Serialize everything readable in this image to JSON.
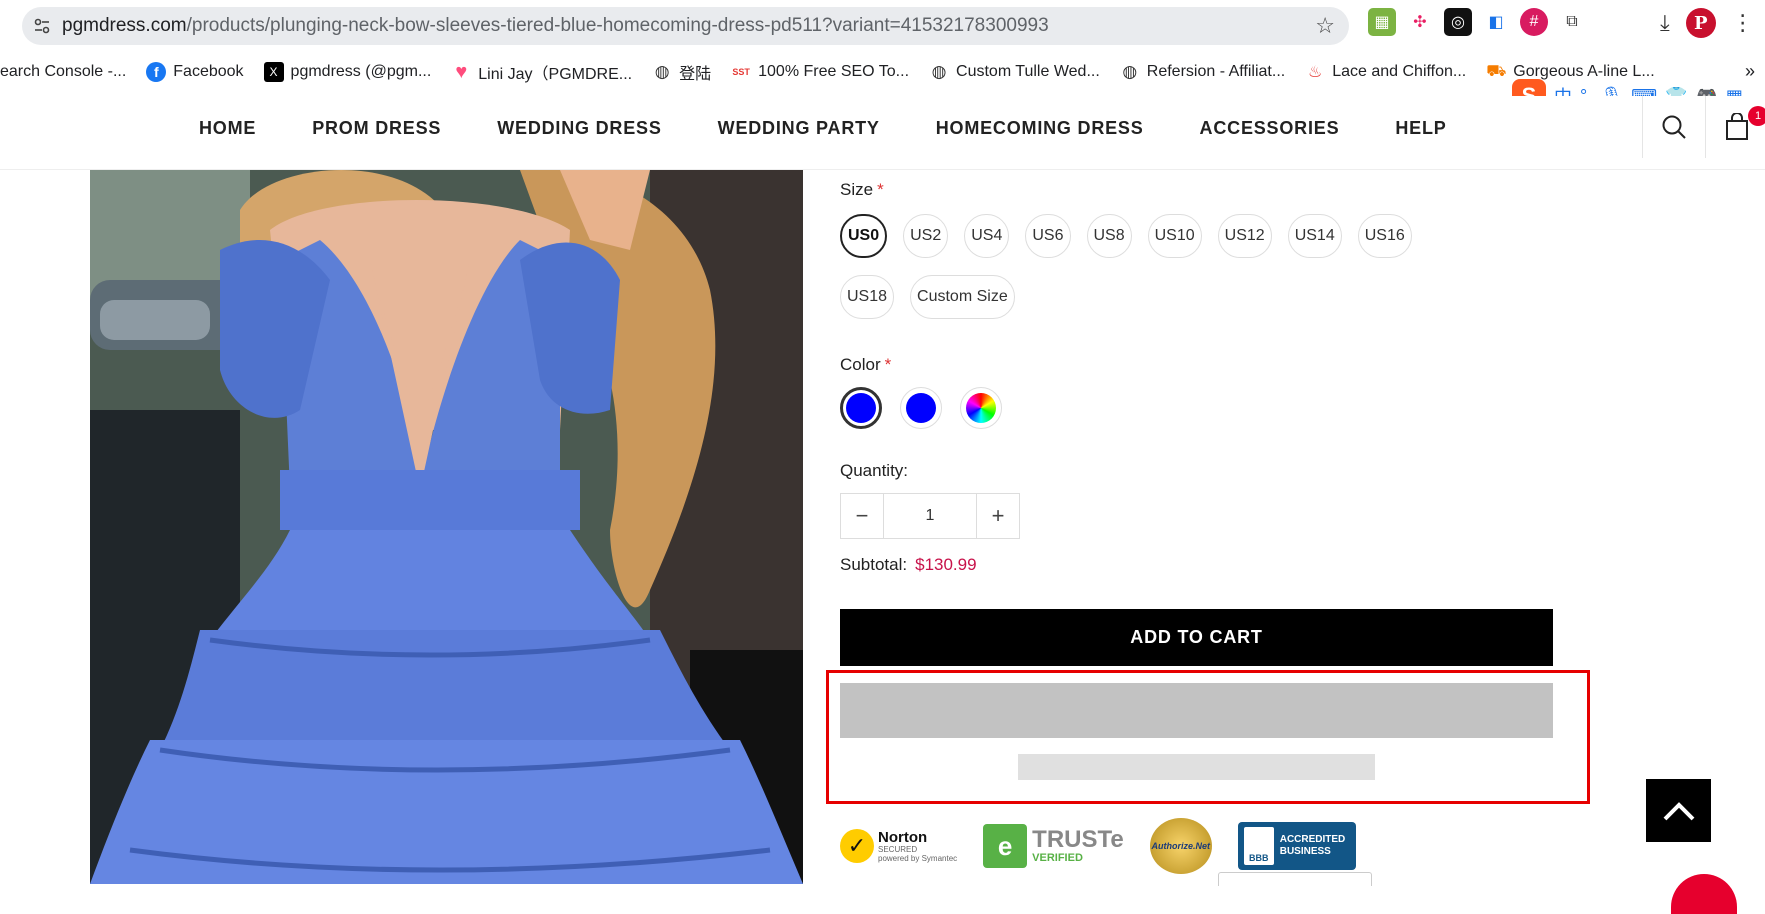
{
  "browser": {
    "url_domain": "pgmdress.com",
    "url_path": "/products/plunging-neck-bow-sleeves-tiered-blue-homecoming-dress-pd511?variant=41532178300993",
    "bookmarks": [
      {
        "label": "earch Console -...",
        "icon": "search-console-icon"
      },
      {
        "label": "Facebook",
        "icon": "facebook-icon"
      },
      {
        "label": "pgmdress (@pgm...",
        "icon": "x-icon"
      },
      {
        "label": "Lini Jay（PGMDRE...",
        "icon": "heart-icon"
      },
      {
        "label": "登陆",
        "icon": "globe-icon"
      },
      {
        "label": "100% Free SEO To...",
        "icon": "sst-icon"
      },
      {
        "label": "Custom Tulle Wed...",
        "icon": "globe-icon"
      },
      {
        "label": "Refersion - Affiliat...",
        "icon": "globe-icon"
      },
      {
        "label": "Lace and Chiffon...",
        "icon": "flame-icon"
      },
      {
        "label": "Gorgeous A-line L...",
        "icon": "cart-icon"
      }
    ],
    "ime": {
      "logo": "S",
      "mode": "中"
    },
    "profile_initial": "P"
  },
  "nav": {
    "items": [
      "HOME",
      "PROM DRESS",
      "WEDDING DRESS",
      "WEDDING PARTY",
      "HOMECOMING DRESS",
      "ACCESSORIES",
      "HELP"
    ],
    "cart_count": "1"
  },
  "product": {
    "size_label": "Size",
    "required_mark": "*",
    "sizes": [
      "US0",
      "US2",
      "US4",
      "US6",
      "US8",
      "US10",
      "US12",
      "US14",
      "US16",
      "US18",
      "Custom Size"
    ],
    "selected_size": "US0",
    "color_label": "Color",
    "colors": [
      {
        "name": "blue-selected",
        "hex": "#0000ff"
      },
      {
        "name": "blue",
        "hex": "#0000ff"
      },
      {
        "name": "custom-multicolor",
        "hex": "rainbow"
      }
    ],
    "quantity_label": "Quantity:",
    "quantity": "1",
    "subtotal_label": "Subtotal:",
    "subtotal_value": "$130.99",
    "add_to_cart": "ADD TO CART"
  },
  "trust_badges": {
    "norton": {
      "title": "Norton",
      "sub": "SECURED",
      "by": "powered by Symantec"
    },
    "truste": {
      "title": "TRUSTe",
      "sub": "VERIFIED"
    },
    "authorize": {
      "title": "Authorize.Net"
    },
    "bbb": {
      "line1": "ACCREDITED",
      "line2": "BUSINESS",
      "mark": "BBB"
    }
  },
  "colors": {
    "accent_price": "#c8124a",
    "highlight": "#e60000",
    "button": "#000000"
  }
}
